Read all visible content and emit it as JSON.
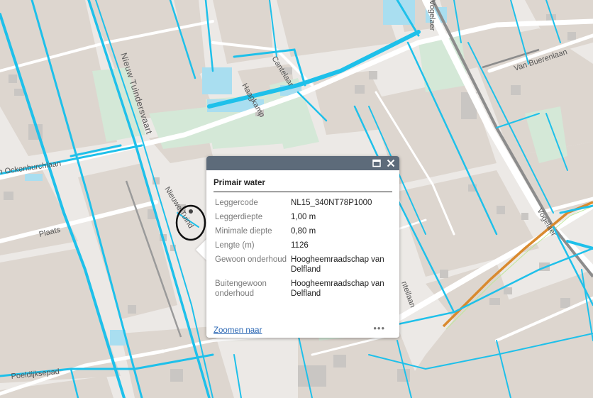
{
  "popup": {
    "title": "Primair water",
    "attributes": [
      {
        "key": "Leggercode",
        "value": "NL15_340NT78P1000"
      },
      {
        "key": "Leggerdiepte",
        "value": "1,00 m"
      },
      {
        "key": "Minimale diepte",
        "value": "0,80 m"
      },
      {
        "key": "Lengte (m)",
        "value": "1126"
      },
      {
        "key": "Gewoon onderhoud",
        "value": "Hoogheemraadschap van Delfland"
      },
      {
        "key": "Buitengewoon onderhoud",
        "value": "Hoogheemraadschap van Delfland"
      }
    ],
    "zoom_link": "Zoomen naar",
    "more_label": "•••",
    "maximize_icon": "maximize-icon",
    "close_icon": "close-icon"
  },
  "map_labels": {
    "nieuw_tuindersvaart": "Nieuw Tuindersvaart",
    "nieuwe_tuinderlabel": "Nieuwe Tuind",
    "ockenburchlaan": "n Ockenburchlaan",
    "plaats": "Plaats",
    "poeldijksepad": "Poeldijksepad",
    "haagkamp": "Haagkamp",
    "cantelaar": "Cantelaar",
    "van_buerenlaan": "Van Buerenlaan",
    "vogelaer_top": "Vogelaer",
    "vogelaer_right": "Vogelaer",
    "mantellaan": "ntellaan"
  },
  "colors": {
    "water_primary": "#1ec0ea",
    "water_area": "#a9def0",
    "land_block": "#ddd6cf",
    "park": "#d7eadb",
    "building": "#c9c6c3",
    "railway": "#8a8a8a",
    "orange_route": "#e08a1e",
    "popup_header": "#5d6b7a",
    "link": "#2a67b4"
  }
}
